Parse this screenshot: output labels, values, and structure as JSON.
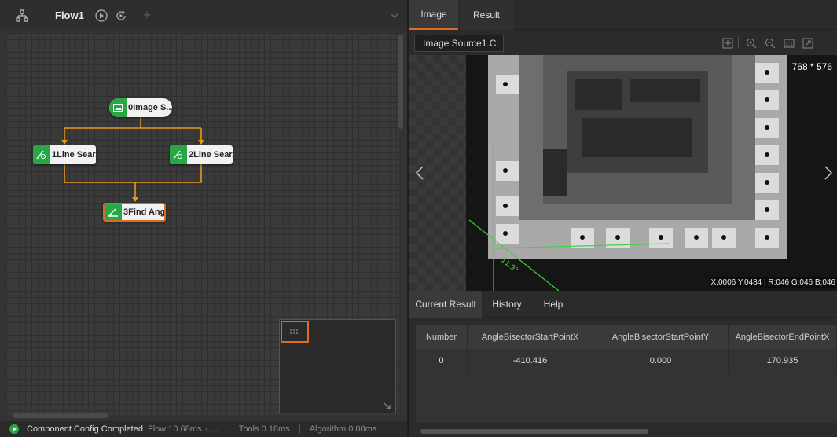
{
  "flow": {
    "tab_label": "Flow1",
    "nodes": [
      {
        "label": "0Image S..."
      },
      {
        "label": "1Line Sear..."
      },
      {
        "label": "2Line Sear..."
      },
      {
        "label": "3Find Ang..."
      }
    ]
  },
  "status": {
    "message": "Component Config Completed",
    "flow_time": "Flow  10.68ms",
    "tools_time": "Tools  0.18ms",
    "algorithm_time": "Algorithm  0.00ms"
  },
  "image_panel": {
    "tabs": [
      "Image",
      "Result"
    ],
    "source": "Image Source1.C",
    "dimensions": "768 * 576",
    "readout": "X,0006  Y,0484  |  R:046  G:046  B:046",
    "measure_angle": "11.9°"
  },
  "result_panel": {
    "tabs": [
      "Current Result",
      "History",
      "Help"
    ],
    "columns": [
      "Number",
      "AngleBisectorStartPointX",
      "AngleBisectorStartPointY",
      "AngleBisectorEndPointX"
    ],
    "rows": [
      [
        "0",
        "-410.416",
        "0.000",
        "170.935"
      ]
    ]
  },
  "colors": {
    "accent": "#e06a1f",
    "node_green": "#27a844",
    "overlay_line": "#3fd13f"
  }
}
